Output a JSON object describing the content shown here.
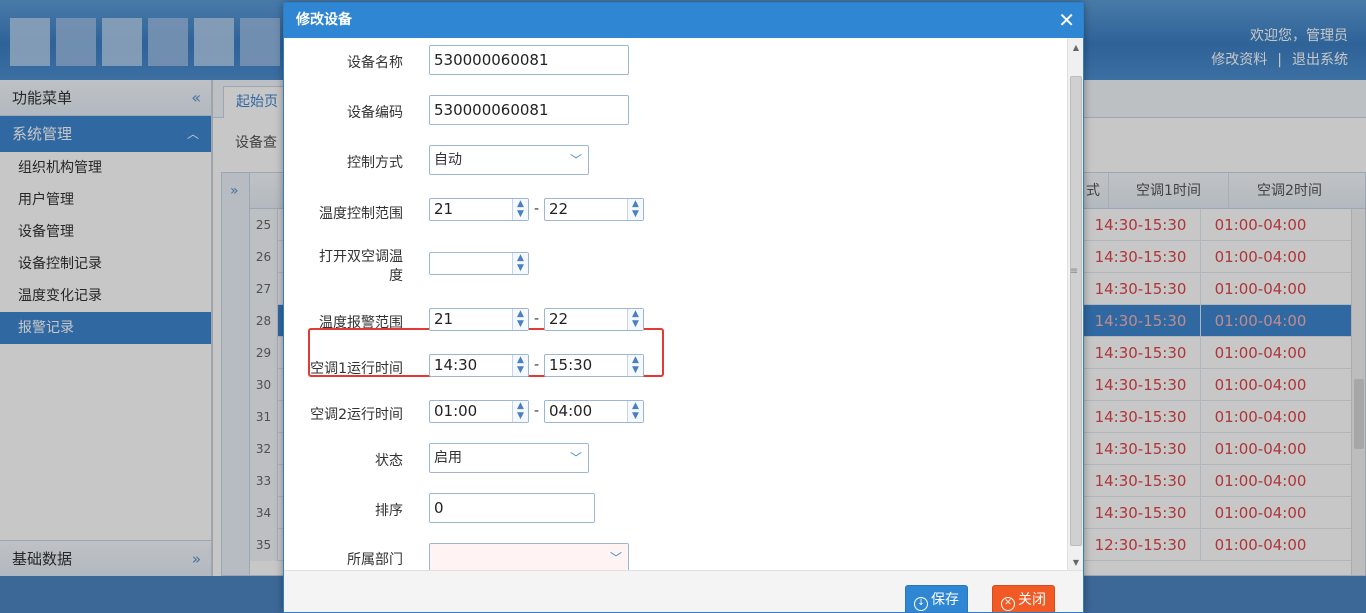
{
  "header": {
    "welcome": "欢迎您，管理员",
    "edit_profile": "修改资料",
    "separator": "|",
    "logout": "退出系统"
  },
  "sidebar": {
    "title": "功能菜单",
    "group": "系统管理",
    "items": [
      "组织机构管理",
      "用户管理",
      "设备管理",
      "设备控制记录",
      "温度变化记录",
      "报警记录"
    ],
    "active_index": 5,
    "footer": "基础数据"
  },
  "main": {
    "tab_home": "起始页",
    "breadcrumb": "设备查",
    "columns": [
      "式",
      "空调1时间",
      "空调2时间"
    ],
    "rows": [
      {
        "num": "25",
        "ac1": "14:30-15:30",
        "ac2": "01:00-04:00"
      },
      {
        "num": "26",
        "ac1": "14:30-15:30",
        "ac2": "01:00-04:00"
      },
      {
        "num": "27",
        "ac1": "14:30-15:30",
        "ac2": "01:00-04:00"
      },
      {
        "num": "28",
        "ac1": "14:30-15:30",
        "ac2": "01:00-04:00"
      },
      {
        "num": "29",
        "ac1": "14:30-15:30",
        "ac2": "01:00-04:00"
      },
      {
        "num": "30",
        "ac1": "14:30-15:30",
        "ac2": "01:00-04:00"
      },
      {
        "num": "31",
        "ac1": "14:30-15:30",
        "ac2": "01:00-04:00"
      },
      {
        "num": "32",
        "ac1": "14:30-15:30",
        "ac2": "01:00-04:00"
      },
      {
        "num": "33",
        "ac1": "14:30-15:30",
        "ac2": "01:00-04:00"
      },
      {
        "num": "34",
        "ac1": "14:30-15:30",
        "ac2": "01:00-04:00"
      },
      {
        "num": "35",
        "ac1": "12:30-15:30",
        "ac2": "01:00-04:00"
      }
    ],
    "selected_row": "28"
  },
  "dialog": {
    "title": "修改设备",
    "close_glyph": "✕",
    "fields": {
      "device_name": {
        "label": "设备名称",
        "value": "530000060081"
      },
      "device_code": {
        "label": "设备编码",
        "value": "530000060081"
      },
      "control_mode": {
        "label": "控制方式",
        "value": "自动"
      },
      "temp_control": {
        "label": "温度控制范围",
        "from": "21",
        "to": "22"
      },
      "dual_ac_temp": {
        "label": "打开双空调温度",
        "value": ""
      },
      "temp_alarm": {
        "label": "温度报警范围",
        "from": "21",
        "to": "22"
      },
      "ac1_time": {
        "label": "空调1运行时间",
        "from": "14:30",
        "to": "15:30"
      },
      "ac2_time": {
        "label": "空调2运行时间",
        "from": "01:00",
        "to": "04:00"
      },
      "status": {
        "label": "状态",
        "value": "启用"
      },
      "sort": {
        "label": "排序",
        "value": "0"
      },
      "department": {
        "label": "所属部门",
        "value": ""
      }
    },
    "range_dash": "-",
    "save_label": "保存",
    "close_label": "关闭"
  },
  "colors": {
    "accent": "#2f86d2",
    "close_button": "#f15a24",
    "time_text": "#e0464a",
    "highlight_border": "#e53935"
  },
  "icons": {
    "save": "download-circle-icon",
    "close": "x-circle-icon",
    "spin_up": "triangle-up-icon",
    "spin_down": "triangle-down-icon",
    "select": "chevron-down-icon"
  }
}
